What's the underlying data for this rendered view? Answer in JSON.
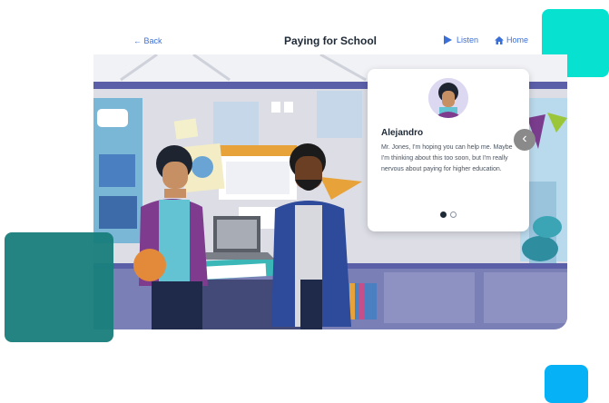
{
  "header": {
    "back_label": "← Back",
    "title": "Paying for School",
    "listen_label": "Listen",
    "home_label": "Home"
  },
  "dialog": {
    "speaker": "Alejandro",
    "text": "Mr. Jones, I'm hoping you can help me. Maybe I'm thinking about this too soon, but I'm really nervous about paying for higher education.",
    "page_count": 2,
    "current_page": 1
  },
  "colors": {
    "accent": "#3b6fd8",
    "cyan": "#07e1cf",
    "teal": "#1a7f7d",
    "blue": "#07b1f5"
  },
  "icons": {
    "listen": "play-icon",
    "home": "home-icon",
    "prev": "chevron-left-icon"
  }
}
